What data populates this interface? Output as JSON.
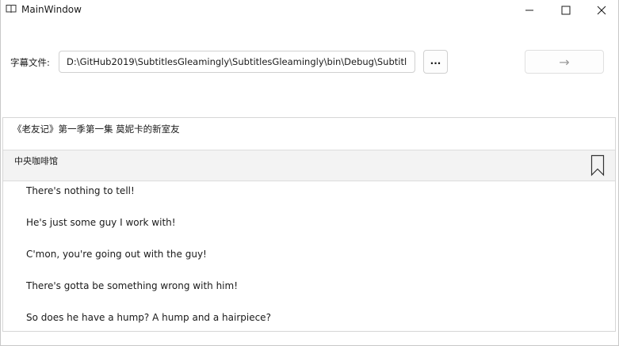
{
  "window": {
    "title": "MainWindow",
    "app_icon": "book-icon",
    "controls": {
      "minimize_icon": "minimize-icon",
      "maximize_icon": "maximize-icon",
      "close_icon": "close-icon"
    }
  },
  "file_picker": {
    "label": "字幕文件:",
    "path": "D:\\GitHub2019\\SubtitlesGleamingly\\SubtitlesGleamingly\\bin\\Debug\\Subtitl",
    "browse_label": "...",
    "go_icon": "arrow-right-icon",
    "go_label": "→"
  },
  "episode": {
    "title": "《老友记》第一季第一集  莫妮卡的新室友"
  },
  "scene": {
    "title": "中央咖啡馆",
    "bookmark_icon": "bookmark-icon"
  },
  "subtitles": [
    "There's nothing to tell!",
    "He's just some guy I work with!",
    "C'mon, you're going out with the guy!",
    "There's gotta be something wrong with him!",
    "So does he have a hump? A hump and a hairpiece?"
  ]
}
